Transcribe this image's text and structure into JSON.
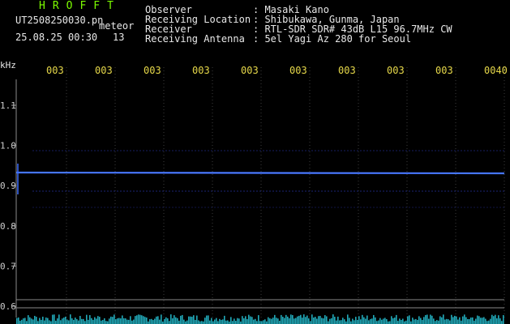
{
  "header": {
    "app_title": "HROFFT",
    "file_name": "UT2508250030.pn",
    "mode": "meteor",
    "date_time": "25.08.25 00:30",
    "count": "13",
    "meta": [
      {
        "key": "Observer",
        "value": ": Masaki Kano"
      },
      {
        "key": "Receiving Location",
        "value": ": Shibukawa, Gunma, Japan"
      },
      {
        "key": "Receiver",
        "value": ": RTL-SDR SDR# 43dB L15 96.7MHz CW"
      },
      {
        "key": "Receiving Antenna",
        "value": ": 5el Yagi Az 280 for Seoul"
      }
    ]
  },
  "axis": {
    "y_unit": "kHz",
    "y_ticks": [
      "1.1",
      "1.0",
      "0.9",
      "0.8",
      "0.7",
      "0.6"
    ],
    "time_ticks": [
      "003",
      "003",
      "003",
      "003",
      "003",
      "003",
      "003",
      "003",
      "003",
      "0040"
    ]
  },
  "colors": {
    "signal": "#3a6cff",
    "faint": "#24309a",
    "grid": "#3c3c3c",
    "time_label": "#e6d84a",
    "noise": "#27c7d9"
  }
}
